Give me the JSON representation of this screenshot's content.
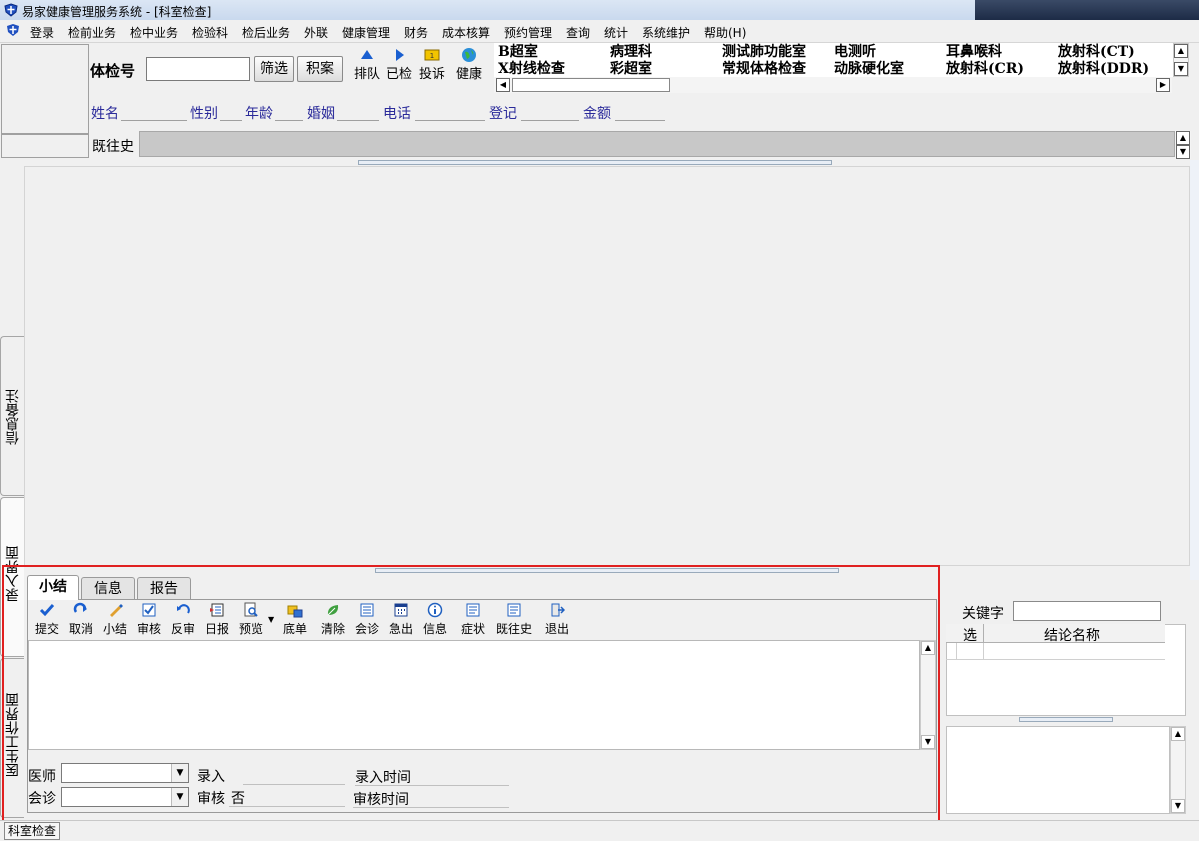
{
  "window": {
    "title": "易家健康管理服务系统 - [科室检查]"
  },
  "menu": [
    "登录",
    "检前业务",
    "检中业务",
    "检验科",
    "检后业务",
    "外联",
    "健康管理",
    "财务",
    "成本核算",
    "预约管理",
    "查询",
    "统计",
    "系统维护",
    "帮助(H)"
  ],
  "search": {
    "label": "体检号",
    "value": "",
    "filter_button": "筛选",
    "archive_button": "积案"
  },
  "quick_tools": [
    "排队",
    "已检",
    "投诉",
    "健康"
  ],
  "departments": [
    "B超室",
    "病理科",
    "测试肺功能室",
    "电测听",
    "耳鼻喉科",
    "放射科(CT)",
    "X射线检查",
    "彩超室",
    "常规体格检查",
    "动脉硬化室",
    "放射科(CR)",
    "放射科(DDR)"
  ],
  "patient_info": {
    "name_label": "姓名",
    "gender_label": "性别",
    "age_label": "年龄",
    "marital_label": "婚姻",
    "phone_label": "电话",
    "register_label": "登记",
    "amount_label": "金额"
  },
  "history": {
    "label": "既往史",
    "value": ""
  },
  "side_tabs": {
    "notes": "信息备注",
    "entry": "录入界面",
    "doctor": "医生工作界面"
  },
  "tabs": [
    "小结",
    "信息",
    "报告"
  ],
  "toolbar": [
    "提交",
    "取消",
    "小结",
    "审核",
    "反审",
    "日报",
    "预览",
    "底单",
    "清除",
    "会诊",
    "急出",
    "信息",
    "症状",
    "既往史",
    "退出"
  ],
  "form": {
    "doctor_label": "医师",
    "doctor_value": "",
    "consult_label": "会诊",
    "consult_value": "",
    "entry_label": "录入",
    "entry_value": "",
    "review_label": "审核",
    "review_value": "否",
    "entry_time_label": "录入时间",
    "review_time_label": "审核时间"
  },
  "conclusion": {
    "keyword_label": "关键字",
    "keyword_value": "",
    "col_select": "选",
    "col_name": "结论名称"
  },
  "status": {
    "text": "科室检查"
  },
  "colors": {
    "red_outline": "#e02020",
    "info_label": "#2a2a9a"
  }
}
